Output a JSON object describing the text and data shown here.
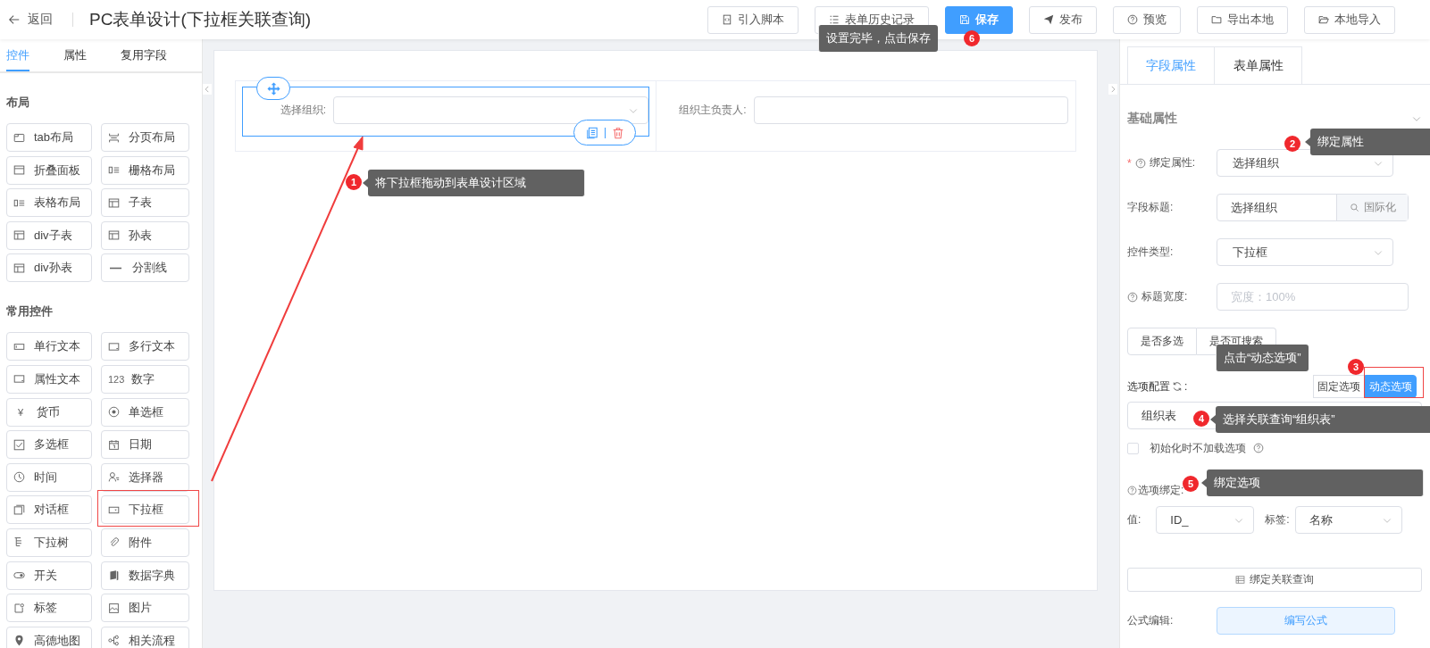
{
  "header": {
    "back": "返回",
    "title": "PC表单设计(下拉框关联查询)",
    "buttons": [
      {
        "label": "引入脚本",
        "primary": false
      },
      {
        "label": "表单历史记录",
        "primary": false
      },
      {
        "label": "保存",
        "primary": true
      },
      {
        "label": "发布",
        "primary": false
      },
      {
        "label": "预览",
        "primary": false
      },
      {
        "label": "导出本地",
        "primary": false
      },
      {
        "label": "本地导入",
        "primary": false
      }
    ]
  },
  "left_panel": {
    "tabs": [
      {
        "label": "控件",
        "selected": true
      },
      {
        "label": "属性",
        "selected": false
      },
      {
        "label": "复用字段",
        "selected": false
      }
    ],
    "groups": [
      {
        "title": "布局",
        "items": [
          {
            "label": "tab布局"
          },
          {
            "label": "分页布局"
          },
          {
            "label": "折叠面板"
          },
          {
            "label": "栅格布局"
          },
          {
            "label": "表格布局"
          },
          {
            "label": "子表"
          },
          {
            "label": "div子表"
          },
          {
            "label": "孙表"
          },
          {
            "label": "div孙表"
          },
          {
            "label": "分割线"
          }
        ]
      },
      {
        "title": "常用控件",
        "items": [
          {
            "label": "单行文本"
          },
          {
            "label": "多行文本"
          },
          {
            "label": "属性文本"
          },
          {
            "label": "数字",
            "glyph": "123"
          },
          {
            "label": "货币",
            "glyph": "¥"
          },
          {
            "label": "单选框"
          },
          {
            "label": "多选框"
          },
          {
            "label": "日期"
          },
          {
            "label": "时间"
          },
          {
            "label": "选择器"
          },
          {
            "label": "对话框"
          },
          {
            "label": "下拉框"
          },
          {
            "label": "下拉树"
          },
          {
            "label": "附件"
          },
          {
            "label": "开关"
          },
          {
            "label": "数据字典"
          },
          {
            "label": "标签"
          },
          {
            "label": "图片"
          },
          {
            "label": "高德地图"
          },
          {
            "label": "相关流程"
          }
        ]
      }
    ]
  },
  "canvas": {
    "fields": [
      {
        "label": "选择组织:",
        "kind": "select",
        "selected": true
      },
      {
        "label": "组织主负责人:",
        "kind": "input",
        "selected": false
      }
    ]
  },
  "right_panel": {
    "tabs": [
      {
        "label": "字段属性",
        "selected": true
      },
      {
        "label": "表单属性",
        "selected": false
      }
    ],
    "section": "基础属性",
    "bind_property": {
      "label": "绑定属性:",
      "required": "*",
      "value": "选择组织"
    },
    "field_title": {
      "label": "字段标题:",
      "value": "选择组织",
      "addon": "国际化"
    },
    "control_type": {
      "label": "控件类型:",
      "value": "下拉框"
    },
    "title_width": {
      "label": "标题宽度:",
      "placeholder": "宽度：100%"
    },
    "toggles": [
      "是否多选",
      "是否可搜索"
    ],
    "option_config": {
      "label": "选项配置",
      "suffix": ":",
      "modes": [
        {
          "label": "固定选项",
          "selected": false
        },
        {
          "label": "动态选项",
          "selected": true
        }
      ],
      "source": "组织表"
    },
    "no_initial_load": {
      "label": "初始化时不加载选项",
      "checked": false
    },
    "option_binding": {
      "label": "选项绑定:",
      "value_label": "值:",
      "value": "ID_",
      "text_label": "标签:",
      "text": "名称"
    },
    "bind_query": "绑定关联查询",
    "formula": {
      "label": "公式编辑:",
      "button": "编写公式"
    }
  },
  "annotations": [
    {
      "number": "1",
      "text": "将下拉框拖动到表单设计区域"
    },
    {
      "number": "2",
      "text": "绑定属性"
    },
    {
      "number": "3",
      "text": "点击“动态选项”"
    },
    {
      "number": "4",
      "text": "选择关联查询“组织表”"
    },
    {
      "number": "5",
      "text": "绑定选项"
    },
    {
      "number": "6",
      "text": "设置完毕，点击保存"
    }
  ]
}
